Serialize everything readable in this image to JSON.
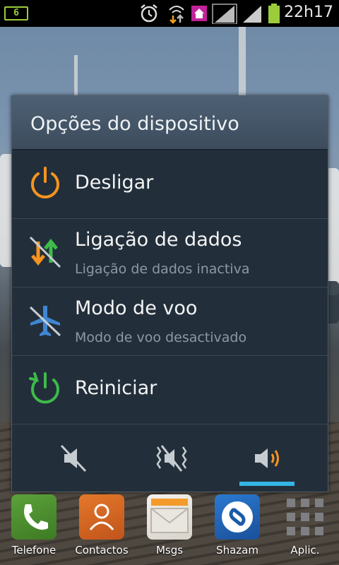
{
  "status_bar": {
    "battery_left_label": "6",
    "time": "22h17",
    "icons": [
      "battery-icon",
      "alarm-icon",
      "data-transfer-icon",
      "home-icon",
      "signal-icon",
      "signal-icon",
      "battery-icon"
    ]
  },
  "dialog": {
    "title": "Opções do dispositivo",
    "options": [
      {
        "label": "Desligar",
        "subtitle": "",
        "icon": "power-icon"
      },
      {
        "label": "Ligação de dados",
        "subtitle": "Ligação de dados inactiva",
        "icon": "data-connection-icon"
      },
      {
        "label": "Modo de voo",
        "subtitle": "Modo de voo desactivado",
        "icon": "airplane-icon"
      },
      {
        "label": "Reiniciar",
        "subtitle": "",
        "icon": "restart-icon"
      }
    ],
    "sound_modes": [
      "mute-icon",
      "vibrate-icon",
      "sound-on-icon"
    ],
    "selected_sound_mode": "sound-on-icon",
    "accent_color": "#33b5e5"
  },
  "dock": {
    "items": [
      {
        "label": "Telefone",
        "icon": "phone-icon"
      },
      {
        "label": "Contactos",
        "icon": "contacts-icon"
      },
      {
        "label": "Msgs",
        "icon": "messages-icon"
      },
      {
        "label": "Shazam",
        "icon": "shazam-icon"
      },
      {
        "label": "Aplic.",
        "icon": "apps-grid-icon"
      }
    ]
  }
}
